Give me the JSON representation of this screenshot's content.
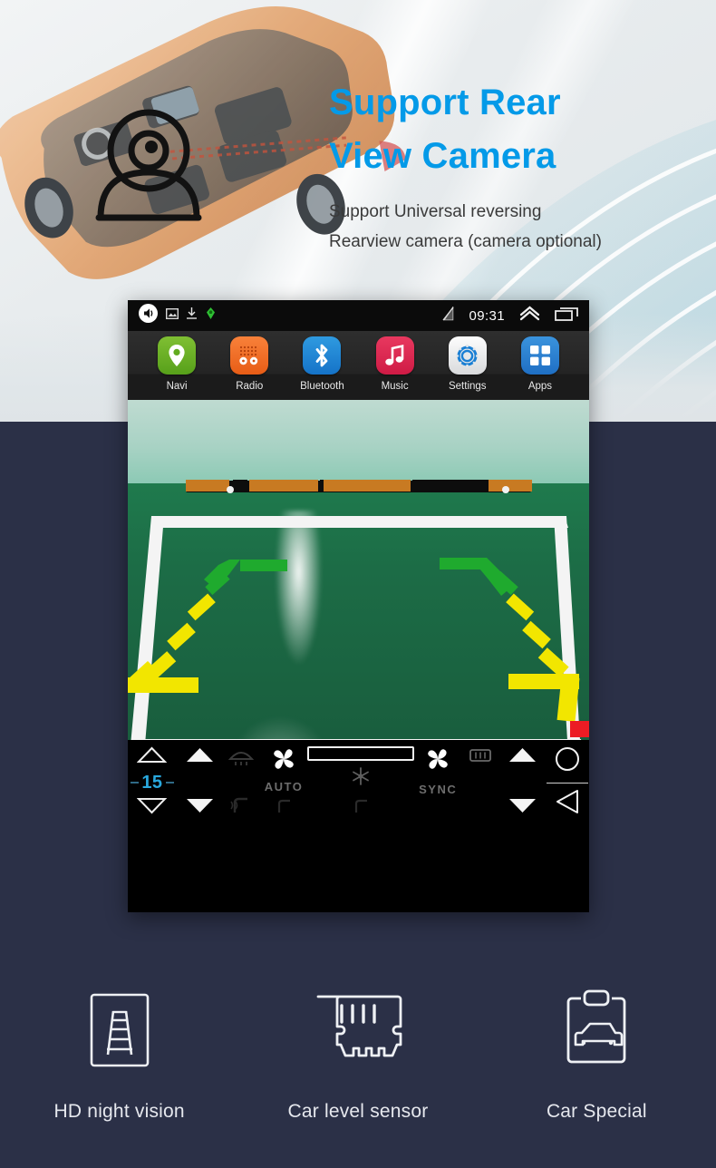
{
  "hero": {
    "heading_line1": "Support Rear",
    "heading_line2": "View Camera",
    "sub_line1": "Support Universal reversing",
    "sub_line2": "Rearview camera (camera optional)",
    "accent_color": "#049ae8",
    "camera_icon": "webcam-icon"
  },
  "device": {
    "statusbar": {
      "volume_icon": "volume-mute-icon",
      "screenshot_icon": "screenshot-icon",
      "download_icon": "download-icon",
      "green_icon": "gps-icon",
      "signal_icon": "signal-off-icon",
      "time": "09:31",
      "expand_icon": "chevron-up-icon",
      "recents_icon": "recents-icon"
    },
    "dock": [
      {
        "label": "Navi",
        "icon": "map-pin-icon"
      },
      {
        "label": "Radio",
        "icon": "radio-icon"
      },
      {
        "label": "Bluetooth",
        "icon": "bluetooth-icon"
      },
      {
        "label": "Music",
        "icon": "music-note-icon"
      },
      {
        "label": "Settings",
        "icon": "gear-icon"
      },
      {
        "label": "Apps",
        "icon": "grid-apps-icon"
      }
    ],
    "camera_view": {
      "description": "rear view camera feed of green floor with parking guide lines",
      "guideline_colors": [
        "#1faa2e",
        "#f2e600",
        "#ec1c24"
      ]
    },
    "climate": {
      "temperature": "15",
      "auto_label": "AUTO",
      "sync_label": "SYNC",
      "fan_icon": "fan-icon",
      "snowflake_icon": "snowflake-icon",
      "front_defrost_icon": "front-defrost-icon",
      "rear_defrost_icon": "rear-defrost-icon",
      "seat_heat_icon": "seat-heat-icon",
      "home_icon": "home-circle-icon",
      "back_icon": "back-triangle-icon",
      "up_icon": "arrow-up-icon",
      "down_icon": "arrow-down-icon"
    }
  },
  "features": [
    {
      "label": "HD night vision",
      "icon": "road-lines-icon"
    },
    {
      "label": "Car level sensor",
      "icon": "sensor-module-icon"
    },
    {
      "label": "Car Special",
      "icon": "car-clipboard-icon"
    }
  ]
}
